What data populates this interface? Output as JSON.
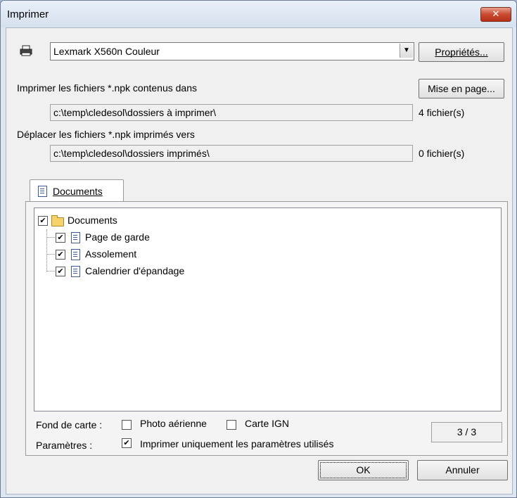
{
  "window": {
    "title": "Imprimer",
    "close_glyph": "✕"
  },
  "printer": {
    "icon": "printer-icon",
    "selected": "Lexmark X560n Couleur",
    "properties_label": "Propriétés..."
  },
  "source": {
    "label": "Imprimer les fichiers *.npk contenus dans",
    "path": "c:\\temp\\cledesol\\dossiers à imprimer\\",
    "count": "4 fichier(s)",
    "page_setup_label": "Mise en page..."
  },
  "destination": {
    "label": "Déplacer les fichiers *.npk imprimés vers",
    "path": "c:\\temp\\cledesol\\dossiers imprimés\\",
    "count": "0 fichier(s)"
  },
  "tab": {
    "label": "Documents"
  },
  "tree": {
    "root": {
      "label": "Documents",
      "checked": true
    },
    "items": [
      {
        "label": "Page de garde",
        "checked": true
      },
      {
        "label": "Assolement",
        "checked": true
      },
      {
        "label": "Calendrier d'épandage",
        "checked": true
      }
    ]
  },
  "options": {
    "basemap_label": "Fond de carte :",
    "aerial_label": "Photo aérienne",
    "aerial_checked": false,
    "ign_label": "Carte IGN",
    "ign_checked": false,
    "params_label": "Paramètres :",
    "params_option_label": "Imprimer uniquement les paramètres utilisés",
    "params_checked": true
  },
  "counter": "3 / 3",
  "buttons": {
    "ok": "OK",
    "cancel": "Annuler"
  }
}
